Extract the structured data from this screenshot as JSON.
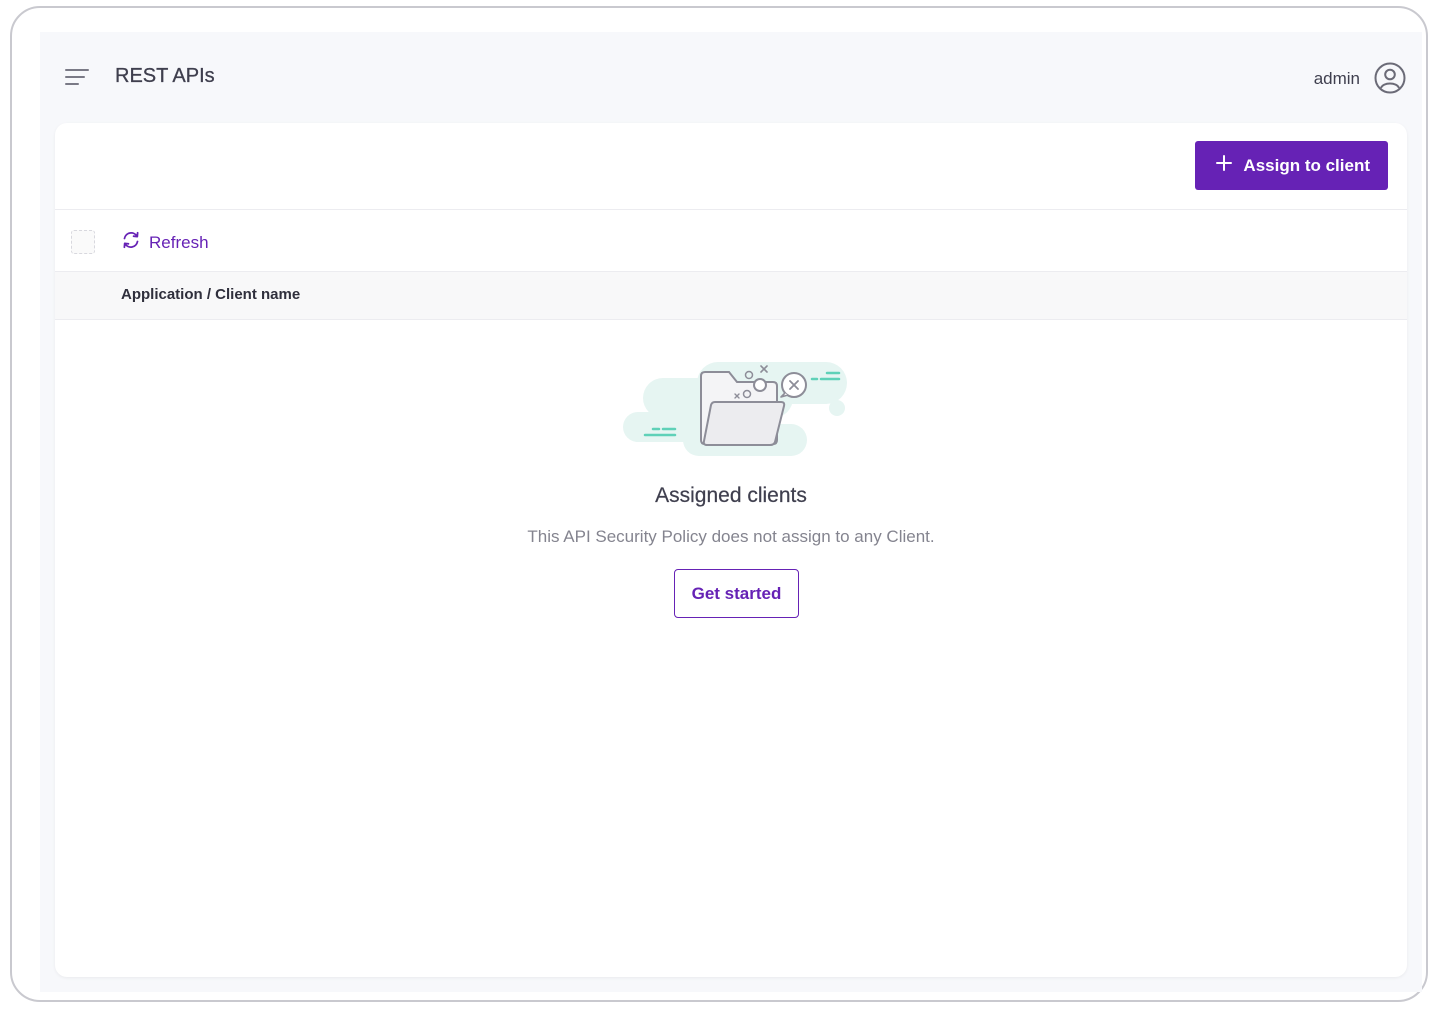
{
  "header": {
    "title": "REST APIs",
    "user": "admin",
    "menu_icon": "hamburger-menu-icon",
    "user_icon": "user-circle-icon"
  },
  "actions": {
    "assign_label": "Assign to client",
    "assign_icon": "plus-icon"
  },
  "toolbar": {
    "refresh_label": "Refresh",
    "refresh_icon": "refresh-icon"
  },
  "table": {
    "columns": [
      "Application / Client name"
    ],
    "rows": []
  },
  "empty_state": {
    "title": "Assigned clients",
    "description": "This API Security Policy does not assign to any Client.",
    "cta_label": "Get started",
    "illustration": "empty-folder-illustration"
  },
  "colors": {
    "accent": "#6622b5",
    "background": "#f7f8fb",
    "illustration_mint": "#e6f5f2",
    "illustration_teal": "#5fd1b8"
  }
}
